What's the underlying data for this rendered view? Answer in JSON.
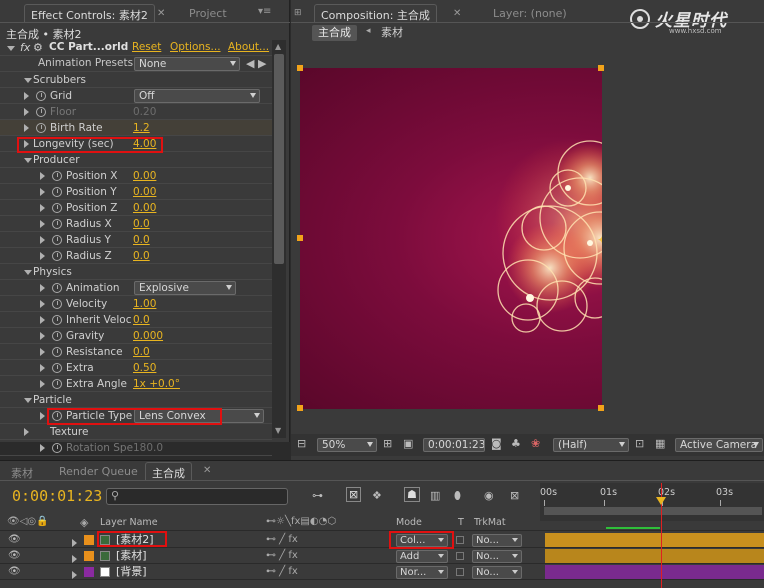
{
  "effect_controls": {
    "tab_label": "Effect Controls: 素材2",
    "project_tab": "Project",
    "breadcrumb": "主合成 • 素材2",
    "effect_name": "CC Part...orld",
    "reset": "Reset",
    "options": "Options...",
    "about": "About...",
    "presets_label": "Animation Presets:",
    "presets_value": "None",
    "rows": [
      {
        "label": "Scrubbers",
        "indent": 0,
        "type": "group",
        "value": ""
      },
      {
        "label": "Grid",
        "indent": 1,
        "type": "dropdown",
        "value": "Off"
      },
      {
        "label": "Floor",
        "indent": 1,
        "type": "dim",
        "value": "0.20"
      },
      {
        "label": "Birth Rate",
        "indent": 1,
        "type": "value",
        "value": "1.2"
      },
      {
        "label": "Longevity (sec)",
        "indent": 0,
        "type": "value",
        "value": "4.00"
      },
      {
        "label": "Producer",
        "indent": 0,
        "type": "group",
        "value": ""
      },
      {
        "label": "Position X",
        "indent": 2,
        "type": "value",
        "value": "0.00"
      },
      {
        "label": "Position Y",
        "indent": 2,
        "type": "value",
        "value": "0.00"
      },
      {
        "label": "Position Z",
        "indent": 2,
        "type": "value",
        "value": "0.00"
      },
      {
        "label": "Radius X",
        "indent": 2,
        "type": "value",
        "value": "0.0"
      },
      {
        "label": "Radius Y",
        "indent": 2,
        "type": "value",
        "value": "0.0"
      },
      {
        "label": "Radius Z",
        "indent": 2,
        "type": "value",
        "value": "0.0"
      },
      {
        "label": "Physics",
        "indent": 0,
        "type": "group",
        "value": ""
      },
      {
        "label": "Animation",
        "indent": 2,
        "type": "dropdown",
        "value": "Explosive"
      },
      {
        "label": "Velocity",
        "indent": 2,
        "type": "value",
        "value": "1.00"
      },
      {
        "label": "Inherit Veloc",
        "indent": 2,
        "type": "value",
        "value": "0.0"
      },
      {
        "label": "Gravity",
        "indent": 2,
        "type": "value",
        "value": "0.000"
      },
      {
        "label": "Resistance",
        "indent": 2,
        "type": "value",
        "value": "0.0"
      },
      {
        "label": "Extra",
        "indent": 2,
        "type": "value",
        "value": "0.50"
      },
      {
        "label": "Extra Angle",
        "indent": 2,
        "type": "value",
        "value": "1x +0.0°"
      },
      {
        "label": "Particle",
        "indent": 0,
        "type": "group",
        "value": ""
      },
      {
        "label": "Particle Type",
        "indent": 2,
        "type": "dropdown",
        "value": "Lens Convex"
      },
      {
        "label": "Texture",
        "indent": 1,
        "type": "group",
        "value": ""
      },
      {
        "label": "Rotation Spe",
        "indent": 2,
        "type": "dim",
        "value": "180.0"
      }
    ]
  },
  "composition": {
    "tab_label": "Composition: 主合成",
    "layer_tab": "Layer: (none)",
    "crumb_active": "主合成",
    "crumb_next": "素材",
    "logo_text": "火星时代",
    "logo_url": "www.hxsd.com",
    "zoom": "50%",
    "timecode": "0:00:01:23",
    "resolution": "(Half)",
    "camera": "Active Camera"
  },
  "timeline": {
    "tabs": [
      "素材",
      "Render Queue",
      "主合成"
    ],
    "timecode": "0:00:01:23",
    "ruler": [
      "00s",
      "01s",
      "02s",
      "03s"
    ],
    "col_layer_name": "Layer Name",
    "col_mode": "Mode",
    "col_t": "T",
    "col_trkmat": "TrkMat",
    "layers": [
      {
        "index": "1",
        "name": "[素材2]",
        "mode": "Col...",
        "trkmat": "No...",
        "color": "#e8901c",
        "bar_color": "#c8901e"
      },
      {
        "index": "2",
        "name": "[素材]",
        "mode": "Add",
        "trkmat": "No...",
        "color": "#e8901c",
        "bar_color": "#b8861c"
      },
      {
        "index": "3",
        "name": "[背景]",
        "mode": "Nor...",
        "trkmat": "No...",
        "color": "#8a2aa0",
        "bar_color": "#7a2a8e"
      }
    ]
  },
  "colors": {
    "accent_value": "#e8b420",
    "highlight_box": "#e01010",
    "timeline_cursor": "#e02020"
  }
}
